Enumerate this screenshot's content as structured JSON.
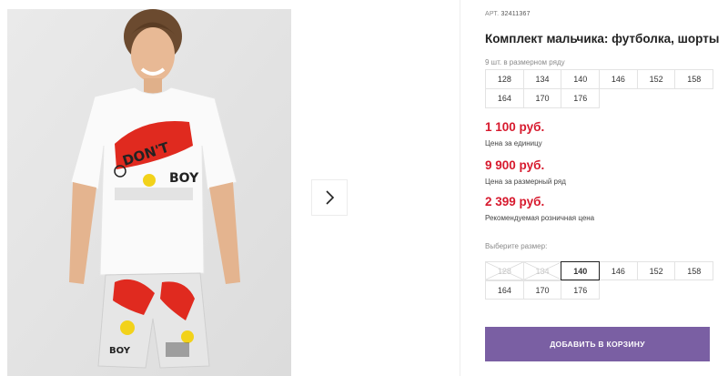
{
  "product": {
    "sku_label": "АРТ.",
    "sku_value": "32411367",
    "title": "Комплект мальчика: футболка, шорты"
  },
  "gallery": {
    "next_icon": "chevron-right-icon"
  },
  "size_row": {
    "note": "9 шт. в размерном ряду",
    "sizes": [
      "128",
      "134",
      "140",
      "146",
      "152",
      "158",
      "164",
      "170",
      "176"
    ]
  },
  "prices": {
    "unit_price": "1 100 руб.",
    "unit_label": "Цена за единицу",
    "row_price": "9 900 руб.",
    "row_label": "Цена за размерный ряд",
    "retail_price": "2 399 руб.",
    "retail_label": "Рекомендуемая розничная цена"
  },
  "size_select": {
    "label": "Выберите размер:",
    "options": [
      {
        "label": "128",
        "state": "disabled"
      },
      {
        "label": "134",
        "state": "disabled"
      },
      {
        "label": "140",
        "state": "selected"
      },
      {
        "label": "146",
        "state": "available"
      },
      {
        "label": "152",
        "state": "available"
      },
      {
        "label": "158",
        "state": "available"
      },
      {
        "label": "164",
        "state": "available"
      },
      {
        "label": "170",
        "state": "available"
      },
      {
        "label": "176",
        "state": "available"
      }
    ]
  },
  "cart": {
    "add_label": "ДОБАВИТЬ В КОРЗИНУ"
  },
  "colors": {
    "price": "#d71a2e",
    "button": "#7a5fa3",
    "selected_border": "#222222"
  }
}
